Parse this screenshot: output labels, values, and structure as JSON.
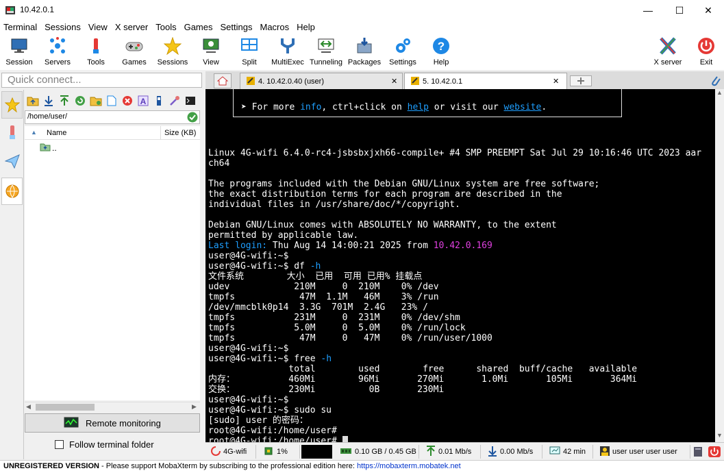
{
  "window": {
    "title": "10.42.0.1",
    "minimize": "—",
    "maximize": "☐",
    "close": "✕"
  },
  "menu": [
    "Terminal",
    "Sessions",
    "View",
    "X server",
    "Tools",
    "Games",
    "Settings",
    "Macros",
    "Help"
  ],
  "toolbar": {
    "session": "Session",
    "servers": "Servers",
    "tools": "Tools",
    "games": "Games",
    "sessions": "Sessions",
    "view": "View",
    "split": "Split",
    "multiexec": "MultiExec",
    "tunneling": "Tunneling",
    "packages": "Packages",
    "settings": "Settings",
    "help": "Help",
    "xserver": "X server",
    "exit": "Exit"
  },
  "quick_connect": {
    "placeholder": "Quick connect..."
  },
  "tabs": [
    {
      "label": "4. 10.42.0.40 (user)",
      "close": "✕"
    },
    {
      "label": "5. 10.42.0.1",
      "close": "✕"
    }
  ],
  "sftp": {
    "path": "/home/user/",
    "col_name": "Name",
    "col_size": "Size (KB)",
    "files": [
      {
        "name": ".."
      }
    ],
    "remote_monitoring": "Remote monitoring",
    "follow_folder": "Follow terminal folder"
  },
  "terminal": {
    "banner_prefix": "➤ For more ",
    "banner_info": "info",
    "banner_mid1": ", ctrl+click on ",
    "banner_help": "help",
    "banner_mid2": " or visit our ",
    "banner_website": "website",
    "banner_suffix": ".",
    "lines_a": [
      "Linux 4G-wifi 6.4.0-rc4-jsbsbxjxh66-compile+ #4 SMP PREEMPT Sat Jul 29 10:16:46 UTC 2023 aar",
      "ch64",
      "",
      "The programs included with the Debian GNU/Linux system are free software;",
      "the exact distribution terms for each program are described in the",
      "individual files in /usr/share/doc/*/copyright.",
      "",
      "Debian GNU/Linux comes with ABSOLUTELY NO WARRANTY, to the extent",
      "permitted by applicable law."
    ],
    "last_login_label": "Last login:",
    "last_login_text": " Thu Aug 14 14:00:21 2025 from ",
    "last_login_ip": "10.42.0.169",
    "prompt1": "user@4G-wifi:~$",
    "df_prompt": "user@4G-wifi:~$ df ",
    "df_flag": "-h",
    "df_lines": [
      "文件系统        大小  已用  可用 已用% 挂载点",
      "udev            210M     0  210M    0% /dev",
      "tmpfs            47M  1.1M   46M    3% /run",
      "/dev/mmcblk0p14  3.3G  701M  2.4G   23% /",
      "tmpfs           231M     0  231M    0% /dev/shm",
      "tmpfs           5.0M     0  5.0M    0% /run/lock",
      "tmpfs            47M     0   47M    0% /run/user/1000"
    ],
    "prompt2": "user@4G-wifi:~$",
    "free_prompt": "user@4G-wifi:~$ free ",
    "free_flag": "-h",
    "free_lines": [
      "               total        used        free      shared  buff/cache   available",
      "内存：          460Mi        96Mi       270Mi       1.0Mi       105Mi       364Mi",
      "交换：          230Mi          0B       230Mi"
    ],
    "lines_b": [
      "user@4G-wifi:~$",
      "user@4G-wifi:~$ sudo su",
      "[sudo] user 的密码：",
      "root@4G-wifi:/home/user#",
      "root@4G-wifi:/home/user# "
    ]
  },
  "status": {
    "host": "4G-wifi",
    "cpu": "1%",
    "disk": "0.10 GB / 0.45 GB",
    "upload": "0.01 Mb/s",
    "download": "0.00 Mb/s",
    "uptime": "42 min",
    "users": "user  user  user  user"
  },
  "footer": {
    "unregistered": "UNREGISTERED VERSION",
    "message": " -  Please support MobaXterm by subscribing to the professional edition here: ",
    "link": "https://mobaxterm.mobatek.net"
  },
  "colors": {
    "accent_green": "#32cd32",
    "accent_cyan": "#1e9fff",
    "accent_magenta": "#e040e0"
  }
}
